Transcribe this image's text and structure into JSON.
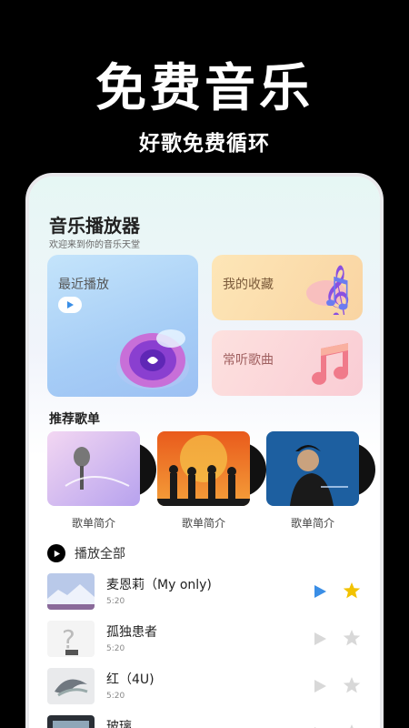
{
  "promo": {
    "title": "免费音乐",
    "subtitle": "好歌免费循环"
  },
  "app": {
    "title": "音乐播放器",
    "subtitle": "欢迎来到你的音乐天堂"
  },
  "cards": {
    "recent": "最近播放",
    "favorites": "我的收藏",
    "often": "常听歌曲"
  },
  "recommend": {
    "title": "推荐歌单",
    "playlists": [
      {
        "label": "歌单简介"
      },
      {
        "label": "歌单简介"
      },
      {
        "label": "歌单简介"
      }
    ]
  },
  "play_all": "播放全部",
  "songs": [
    {
      "title": "麦恩莉（My only)",
      "duration": "5:20",
      "active": true
    },
    {
      "title": "孤独患者",
      "duration": "5:20",
      "active": false
    },
    {
      "title": "红（4U)",
      "duration": "5:20",
      "active": false
    },
    {
      "title": "玻璃",
      "duration": "",
      "active": false
    }
  ],
  "colors": {
    "accent_play": "#3a8ee6",
    "accent_star": "#f2c200",
    "inactive": "#d8d8d8"
  },
  "icons": [
    "play-icon",
    "star-icon",
    "disc-icon",
    "treble-clef-icon",
    "music-note-icon"
  ]
}
